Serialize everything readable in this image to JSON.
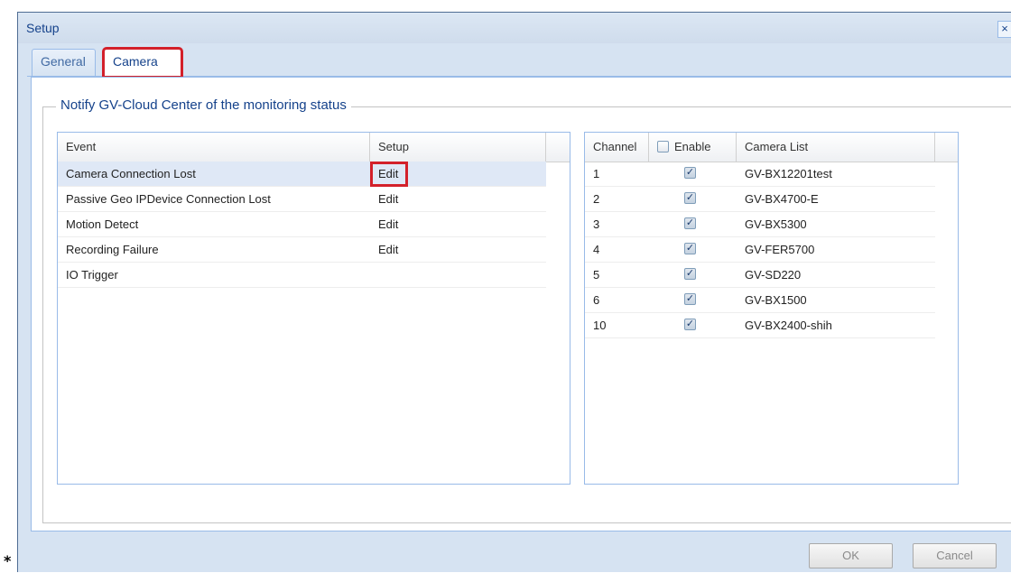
{
  "dialog": {
    "title": "Setup",
    "close_glyph": "×"
  },
  "tabs": [
    {
      "label": "General"
    },
    {
      "label": "Camera"
    }
  ],
  "section": {
    "legend": "Notify GV-Cloud Center of the monitoring status"
  },
  "events_grid": {
    "columns": [
      "Event",
      "Setup"
    ],
    "rows": [
      {
        "event": "Camera Connection Lost",
        "setup": "Edit"
      },
      {
        "event": "Passive Geo IPDevice Connection Lost",
        "setup": "Edit"
      },
      {
        "event": "Motion Detect",
        "setup": "Edit"
      },
      {
        "event": "Recording Failure",
        "setup": "Edit"
      },
      {
        "event": "IO Trigger",
        "setup": ""
      }
    ]
  },
  "camera_grid": {
    "columns": [
      "Channel",
      "Enable",
      "Camera List"
    ],
    "rows": [
      {
        "channel": "1",
        "camera": "GV-BX12201test"
      },
      {
        "channel": "2",
        "camera": "GV-BX4700-E"
      },
      {
        "channel": "3",
        "camera": "GV-BX5300"
      },
      {
        "channel": "4",
        "camera": "GV-FER5700"
      },
      {
        "channel": "5",
        "camera": "GV-SD220"
      },
      {
        "channel": "6",
        "camera": "GV-BX1500"
      },
      {
        "channel": "10",
        "camera": "GV-BX2400-shih"
      }
    ]
  },
  "footer": {
    "ok_label": "OK",
    "cancel_label": "Cancel"
  },
  "marker": "*",
  "colors": {
    "highlight": "#d3202a",
    "header_text": "#15428b",
    "frame": "#99bbe8"
  }
}
